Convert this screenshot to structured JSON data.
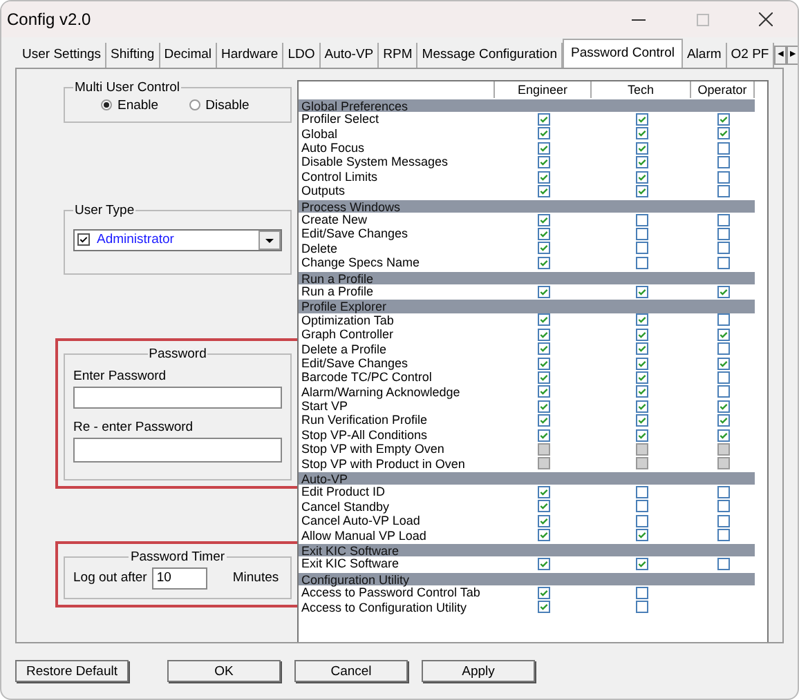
{
  "window": {
    "title": "Config v2.0"
  },
  "tabs": [
    {
      "label": "User Settings",
      "selected": false
    },
    {
      "label": "Shifting",
      "selected": false
    },
    {
      "label": "Decimal",
      "selected": false
    },
    {
      "label": "Hardware",
      "selected": false
    },
    {
      "label": "LDO",
      "selected": false
    },
    {
      "label": "Auto-VP",
      "selected": false
    },
    {
      "label": "RPM",
      "selected": false
    },
    {
      "label": "Message Configuration",
      "selected": false
    },
    {
      "label": "Password Control",
      "selected": true
    },
    {
      "label": "Alarm",
      "selected": false
    },
    {
      "label": "O2 PF",
      "selected": false
    }
  ],
  "tab_scroll": [
    "◄",
    "►"
  ],
  "multi_user_control": {
    "title": "Multi User Control",
    "options": [
      {
        "label": "Enable",
        "selected": true
      },
      {
        "label": "Disable",
        "selected": false
      }
    ]
  },
  "user_type": {
    "title": "User Type",
    "value": "Administrator",
    "checked": true
  },
  "password": {
    "title": "Password",
    "highlighted": true,
    "enter_label": "Enter Password",
    "reenter_label": "Re - enter Password"
  },
  "password_timer": {
    "title": "Password Timer",
    "highlighted": true,
    "prefix": "Log out after",
    "value": "10",
    "suffix": "Minutes"
  },
  "table": {
    "columns": [
      "Engineer",
      "Tech",
      "Operator"
    ],
    "sections": [
      {
        "title": "Global Preferences",
        "rows": [
          {
            "label": "Profiler Select",
            "cells": [
              {
                "checked": true,
                "disabled": false
              },
              {
                "checked": true,
                "disabled": false
              },
              {
                "checked": true,
                "disabled": false
              }
            ]
          },
          {
            "label": "Global",
            "cells": [
              {
                "checked": true,
                "disabled": false
              },
              {
                "checked": true,
                "disabled": false
              },
              {
                "checked": true,
                "disabled": false
              }
            ]
          },
          {
            "label": "Auto Focus",
            "cells": [
              {
                "checked": true,
                "disabled": false
              },
              {
                "checked": true,
                "disabled": false
              },
              {
                "checked": false,
                "disabled": false
              }
            ]
          },
          {
            "label": "Disable System Messages",
            "cells": [
              {
                "checked": true,
                "disabled": false
              },
              {
                "checked": true,
                "disabled": false
              },
              {
                "checked": false,
                "disabled": false
              }
            ]
          },
          {
            "label": "Control Limits",
            "cells": [
              {
                "checked": true,
                "disabled": false
              },
              {
                "checked": true,
                "disabled": false
              },
              {
                "checked": false,
                "disabled": false
              }
            ]
          },
          {
            "label": "Outputs",
            "cells": [
              {
                "checked": true,
                "disabled": false
              },
              {
                "checked": true,
                "disabled": false
              },
              {
                "checked": false,
                "disabled": false
              }
            ]
          }
        ]
      },
      {
        "title": "Process Windows",
        "rows": [
          {
            "label": "Create New",
            "cells": [
              {
                "checked": true,
                "disabled": false
              },
              {
                "checked": false,
                "disabled": false
              },
              {
                "checked": false,
                "disabled": false
              }
            ]
          },
          {
            "label": "Edit/Save Changes",
            "cells": [
              {
                "checked": true,
                "disabled": false
              },
              {
                "checked": false,
                "disabled": false
              },
              {
                "checked": false,
                "disabled": false
              }
            ]
          },
          {
            "label": "Delete",
            "cells": [
              {
                "checked": true,
                "disabled": false
              },
              {
                "checked": false,
                "disabled": false
              },
              {
                "checked": false,
                "disabled": false
              }
            ]
          },
          {
            "label": "Change Specs Name",
            "cells": [
              {
                "checked": true,
                "disabled": false
              },
              {
                "checked": false,
                "disabled": false
              },
              {
                "checked": false,
                "disabled": false
              }
            ]
          }
        ]
      },
      {
        "title": "Run a Profile",
        "rows": [
          {
            "label": "Run a Profile",
            "cells": [
              {
                "checked": true,
                "disabled": false
              },
              {
                "checked": true,
                "disabled": false
              },
              {
                "checked": true,
                "disabled": false
              }
            ]
          }
        ]
      },
      {
        "title": "Profile Explorer",
        "rows": [
          {
            "label": "Optimization Tab",
            "cells": [
              {
                "checked": true,
                "disabled": false
              },
              {
                "checked": true,
                "disabled": false
              },
              {
                "checked": false,
                "disabled": false
              }
            ]
          },
          {
            "label": "Graph Controller",
            "cells": [
              {
                "checked": true,
                "disabled": false
              },
              {
                "checked": true,
                "disabled": false
              },
              {
                "checked": true,
                "disabled": false
              }
            ]
          },
          {
            "label": "Delete a Profile",
            "cells": [
              {
                "checked": true,
                "disabled": false
              },
              {
                "checked": true,
                "disabled": false
              },
              {
                "checked": false,
                "disabled": false
              }
            ]
          },
          {
            "label": "Edit/Save Changes",
            "cells": [
              {
                "checked": true,
                "disabled": false
              },
              {
                "checked": true,
                "disabled": false
              },
              {
                "checked": true,
                "disabled": false
              }
            ]
          },
          {
            "label": "Barcode TC/PC Control",
            "cells": [
              {
                "checked": true,
                "disabled": false
              },
              {
                "checked": true,
                "disabled": false
              },
              {
                "checked": false,
                "disabled": false
              }
            ]
          },
          {
            "label": "Alarm/Warning Acknowledge",
            "cells": [
              {
                "checked": true,
                "disabled": false
              },
              {
                "checked": true,
                "disabled": false
              },
              {
                "checked": false,
                "disabled": false
              }
            ]
          },
          {
            "label": "Start VP",
            "cells": [
              {
                "checked": true,
                "disabled": false
              },
              {
                "checked": true,
                "disabled": false
              },
              {
                "checked": true,
                "disabled": false
              }
            ]
          },
          {
            "label": "Run Verification Profile",
            "cells": [
              {
                "checked": true,
                "disabled": false
              },
              {
                "checked": true,
                "disabled": false
              },
              {
                "checked": true,
                "disabled": false
              }
            ]
          },
          {
            "label": "Stop VP-All Conditions",
            "cells": [
              {
                "checked": true,
                "disabled": false
              },
              {
                "checked": true,
                "disabled": false
              },
              {
                "checked": true,
                "disabled": false
              }
            ]
          },
          {
            "label": "Stop VP with Empty Oven",
            "cells": [
              {
                "checked": false,
                "disabled": true
              },
              {
                "checked": false,
                "disabled": true
              },
              {
                "checked": false,
                "disabled": true
              }
            ]
          },
          {
            "label": "Stop VP with Product in Oven",
            "cells": [
              {
                "checked": false,
                "disabled": true
              },
              {
                "checked": false,
                "disabled": true
              },
              {
                "checked": false,
                "disabled": true
              }
            ]
          }
        ]
      },
      {
        "title": "Auto-VP",
        "rows": [
          {
            "label": "Edit Product ID",
            "cells": [
              {
                "checked": true,
                "disabled": false
              },
              {
                "checked": false,
                "disabled": false
              },
              {
                "checked": false,
                "disabled": false
              }
            ]
          },
          {
            "label": "Cancel Standby",
            "cells": [
              {
                "checked": true,
                "disabled": false
              },
              {
                "checked": false,
                "disabled": false
              },
              {
                "checked": false,
                "disabled": false
              }
            ]
          },
          {
            "label": "Cancel Auto-VP Load",
            "cells": [
              {
                "checked": true,
                "disabled": false
              },
              {
                "checked": false,
                "disabled": false
              },
              {
                "checked": false,
                "disabled": false
              }
            ]
          },
          {
            "label": "Allow Manual VP Load",
            "cells": [
              {
                "checked": true,
                "disabled": false
              },
              {
                "checked": true,
                "disabled": false
              },
              {
                "checked": false,
                "disabled": false
              }
            ]
          }
        ]
      },
      {
        "title": "Exit KIC Software",
        "rows": [
          {
            "label": "Exit KIC Software",
            "cells": [
              {
                "checked": true,
                "disabled": false
              },
              {
                "checked": true,
                "disabled": false
              },
              {
                "checked": false,
                "disabled": false
              }
            ]
          }
        ]
      },
      {
        "title": "Configuration Utility",
        "rows": [
          {
            "label": "Access to Password Control Tab",
            "cells": [
              {
                "checked": true,
                "disabled": false
              },
              {
                "checked": false,
                "disabled": false
              },
              null
            ]
          },
          {
            "label": "Access to Configuration Utility",
            "cells": [
              {
                "checked": true,
                "disabled": false
              },
              {
                "checked": false,
                "disabled": false
              },
              null
            ]
          }
        ]
      }
    ]
  },
  "buttons": {
    "restore": "Restore Default",
    "actions": [
      "OK",
      "Cancel",
      "Apply"
    ]
  }
}
